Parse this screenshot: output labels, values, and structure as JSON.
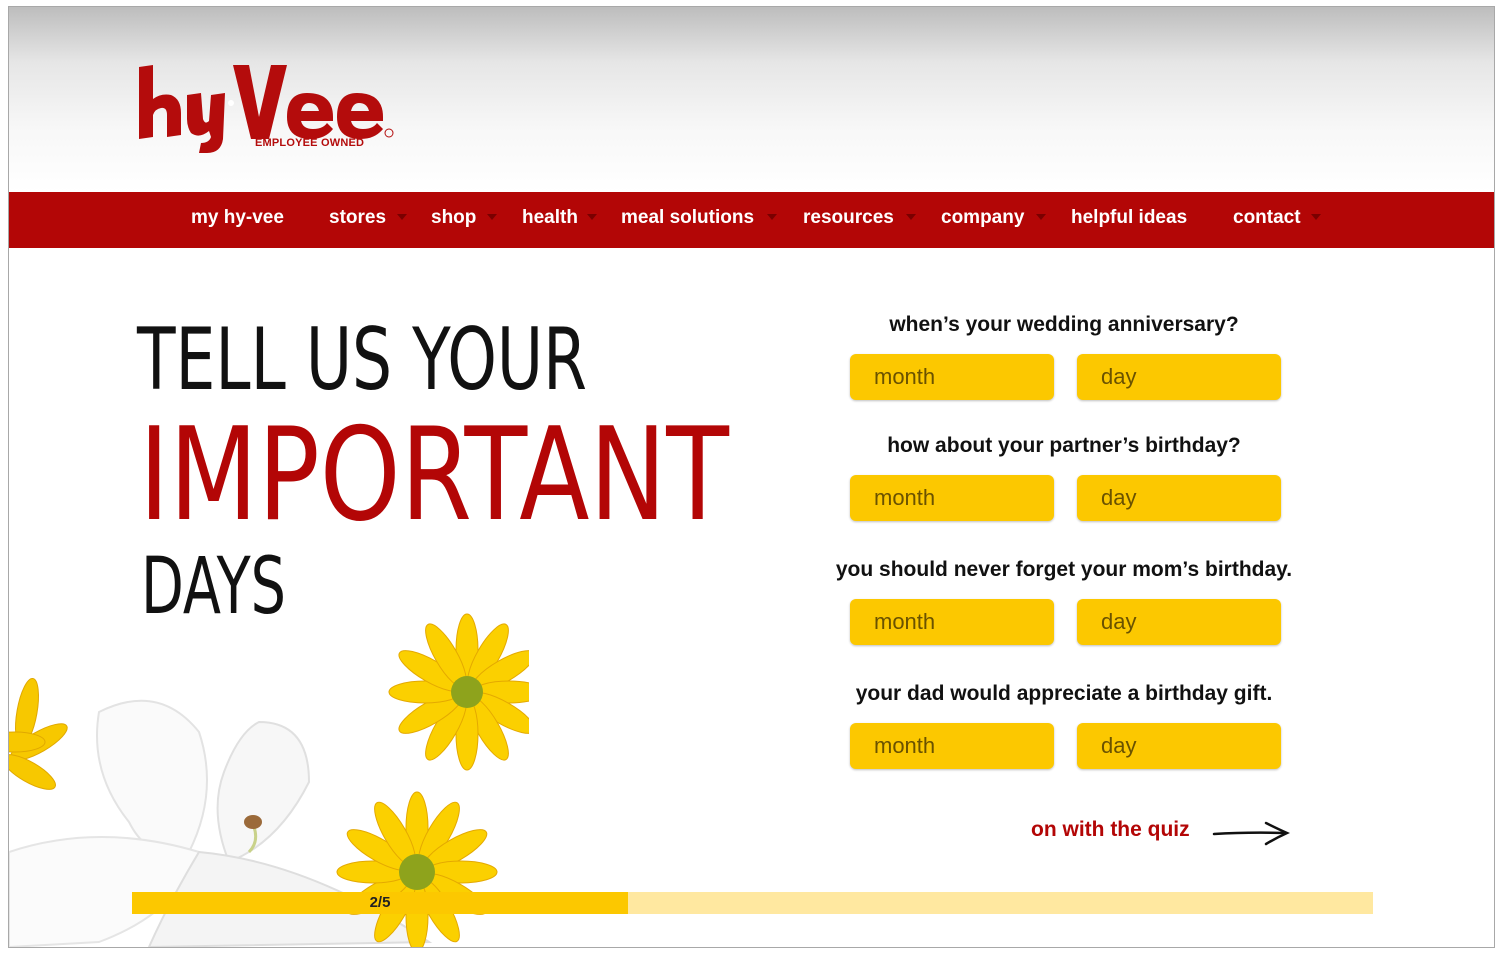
{
  "brand": {
    "name": "Hy-Vee",
    "tagline": "EMPLOYEE OWNED",
    "color": "#b30606",
    "accent": "#fcc800"
  },
  "nav": {
    "items": [
      {
        "label": "my hy-vee",
        "has_dropdown": false
      },
      {
        "label": "stores",
        "has_dropdown": true
      },
      {
        "label": "shop",
        "has_dropdown": true
      },
      {
        "label": "health",
        "has_dropdown": true
      },
      {
        "label": "meal solutions",
        "has_dropdown": true
      },
      {
        "label": "resources",
        "has_dropdown": true
      },
      {
        "label": "company",
        "has_dropdown": true
      },
      {
        "label": "helpful ideas",
        "has_dropdown": false
      },
      {
        "label": "contact",
        "has_dropdown": true
      }
    ]
  },
  "headline": {
    "line1": "TELL US YOUR",
    "line2": "IMPORTANT",
    "line3": "DAYS"
  },
  "questions": [
    {
      "label": "when’s your wedding anniversary?",
      "month_placeholder": "month",
      "day_placeholder": "day"
    },
    {
      "label": "how about your partner’s birthday?",
      "month_placeholder": "month",
      "day_placeholder": "day"
    },
    {
      "label": "you should never forget your mom’s birthday.",
      "month_placeholder": "month",
      "day_placeholder": "day"
    },
    {
      "label": "your dad would appreciate a birthday gift.",
      "month_placeholder": "month",
      "day_placeholder": "day"
    }
  ],
  "next_link": {
    "label": "on with the quiz",
    "icon": "arrow-right-icon"
  },
  "progress": {
    "label": "2/5",
    "current": 2,
    "total": 5,
    "fraction": 0.4
  }
}
